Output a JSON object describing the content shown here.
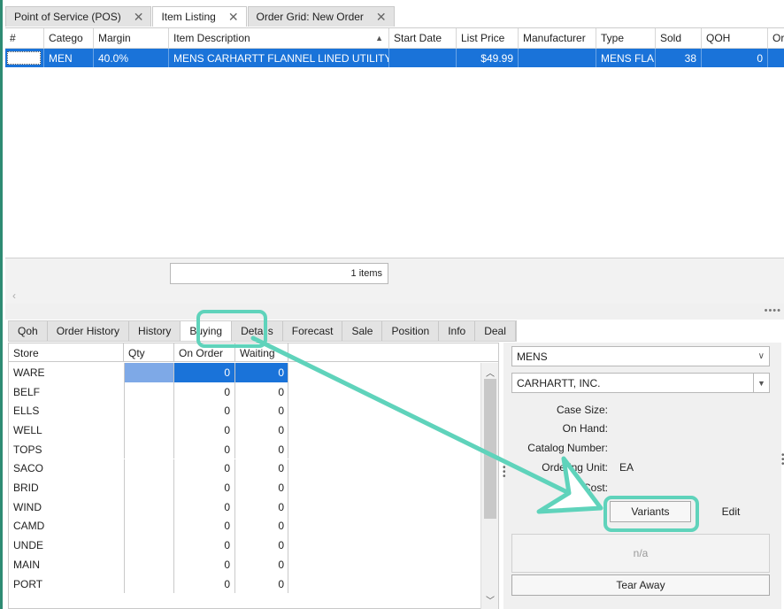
{
  "doc_tabs": [
    {
      "label": "Point of Service (POS)",
      "active": false
    },
    {
      "label": "Item Listing",
      "active": true
    },
    {
      "label": "Order Grid: New Order",
      "active": false
    }
  ],
  "grid": {
    "headers": [
      "#",
      "Catego",
      "Margin",
      "Item Description",
      "Start Date",
      "List Price",
      "Manufacturer",
      "Type",
      "Sold",
      "QOH",
      "Or"
    ],
    "row": {
      "category": "MEN",
      "margin": "40.0%",
      "description": "MENS CARHARTT FLANNEL LINED UTILITY",
      "start_date": "",
      "list_price": "$49.99",
      "manufacturer": "",
      "type": "MENS FLA",
      "sold": "38",
      "qoh": "0"
    },
    "items_count": "1 items"
  },
  "sub_tabs": [
    "Qoh",
    "Order History",
    "History",
    "Buying",
    "Details",
    "Forecast",
    "Sale",
    "Position",
    "Info",
    "Deal"
  ],
  "active_sub_tab": "Buying",
  "store_table": {
    "headers": {
      "store": "Store",
      "qty": "Qty",
      "on_order": "On Order",
      "waiting": "Waiting"
    },
    "rows": [
      {
        "store": "WARE",
        "on_order": "0",
        "waiting": "0"
      },
      {
        "store": "BELF",
        "on_order": "0",
        "waiting": "0"
      },
      {
        "store": "ELLS",
        "on_order": "0",
        "waiting": "0"
      },
      {
        "store": "WELL",
        "on_order": "0",
        "waiting": "0"
      },
      {
        "store": "TOPS",
        "on_order": "0",
        "waiting": "0"
      },
      {
        "store": "SACO",
        "on_order": "0",
        "waiting": "0"
      },
      {
        "store": "BRID",
        "on_order": "0",
        "waiting": "0"
      },
      {
        "store": "WIND",
        "on_order": "0",
        "waiting": "0"
      },
      {
        "store": "CAMD",
        "on_order": "0",
        "waiting": "0"
      },
      {
        "store": "UNDE",
        "on_order": "0",
        "waiting": "0"
      },
      {
        "store": "MAIN",
        "on_order": "0",
        "waiting": "0"
      },
      {
        "store": "PORT",
        "on_order": "0",
        "waiting": "0"
      }
    ]
  },
  "right_panel": {
    "category_select": "MENS",
    "vendor_select": "CARHARTT, INC.",
    "case_size_label": "Case Size:",
    "on_hand_label": "On Hand:",
    "catalog_number_label": "Catalog Number:",
    "ordering_unit_label": "Ordering Unit:",
    "ordering_unit_value": "EA",
    "cost_label": "Cost:",
    "variants_label": "Variants",
    "edit_label": "Edit",
    "na_label": "n/a",
    "tear_away_label": "Tear Away"
  },
  "colors": {
    "selection": "#1a73d9",
    "annotation": "#5fd3bb",
    "frame": "#2e8b73"
  }
}
